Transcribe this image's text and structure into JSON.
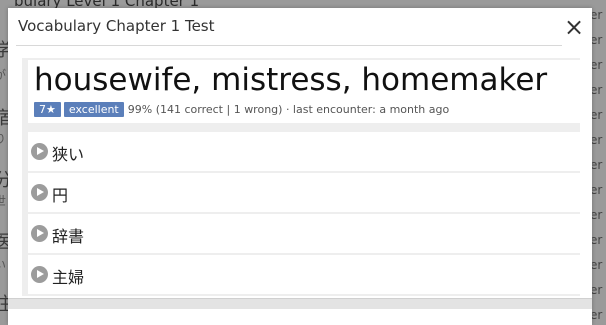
{
  "background": {
    "title": "bulary Level 1 Chapter 1",
    "left_chars": [
      "学",
      "が",
      "宿",
      "り",
      "分",
      "世",
      "医",
      "い",
      "注"
    ],
    "right_fragments": [
      "er",
      "er",
      "er",
      "er",
      "er",
      "er",
      "er",
      "er",
      "er",
      "er",
      "er",
      "er",
      "er"
    ]
  },
  "modal": {
    "title": "Vocabulary Chapter 1 Test",
    "close_symbol": "×"
  },
  "card": {
    "word": "housewife, mistress, homemaker",
    "level_badge": "7★",
    "grade_badge": "excellent",
    "stats": "99% (141 correct | 1 wrong)  · last encounter: a month ago"
  },
  "choices": [
    {
      "label": "狭い"
    },
    {
      "label": "円"
    },
    {
      "label": "辞書"
    },
    {
      "label": "主婦"
    }
  ],
  "colors": {
    "badge": "#5b7fba",
    "backdrop": "#9a9a9a",
    "panel": "#eeeeee",
    "play_icon": "#9c9c9c"
  }
}
